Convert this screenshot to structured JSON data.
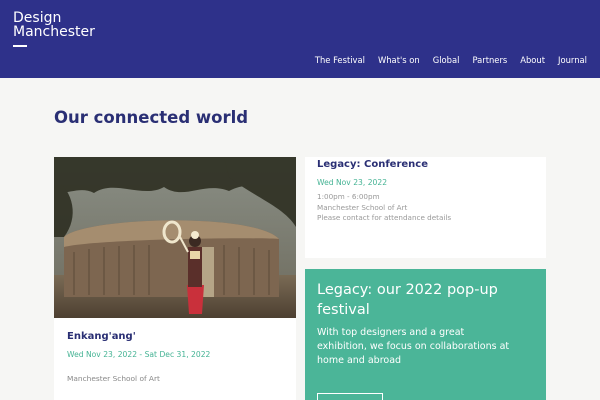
{
  "brand": {
    "line1": "Design",
    "line2": "Manchester"
  },
  "nav": [
    "The Festival",
    "What's on",
    "Global",
    "Partners",
    "About",
    "Journal"
  ],
  "page": {
    "title": "Our connected world"
  },
  "events": [
    {
      "title": "Enkang'ang'",
      "date": "Wed Nov 23, 2022 - Sat Dec 31, 2022",
      "location": "Manchester School of Art"
    },
    {
      "title": "Legacy: Conference",
      "date": "Wed Nov 23, 2022",
      "time": "1:00pm - 6:00pm",
      "location": "Manchester School of Art",
      "note": "Please contact for attendance details"
    }
  ],
  "promo": {
    "heading": "Legacy: our 2022 pop-up festival",
    "body": "With top designers and a great exhibition, we focus on collaborations at home and abroad"
  },
  "colors": {
    "header": "#2e318a",
    "accent": "#4bb598",
    "title": "#2a2f74"
  }
}
